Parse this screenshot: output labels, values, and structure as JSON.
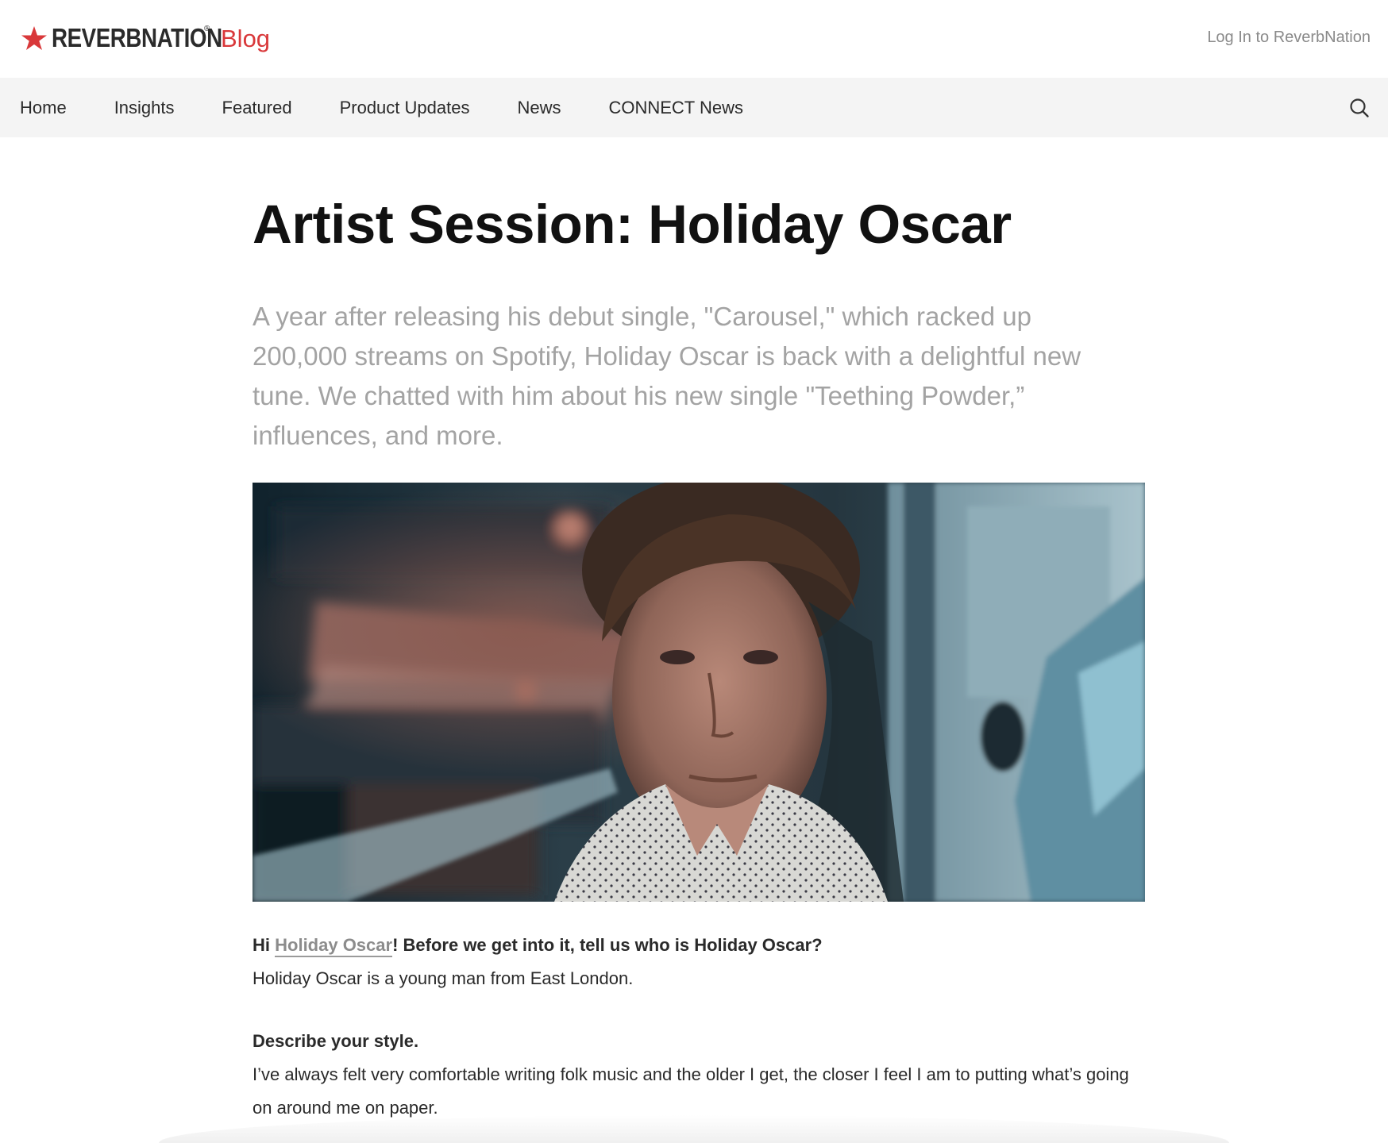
{
  "header": {
    "brand_name": "REVERBNATION",
    "brand_registered": "®",
    "brand_section": "Blog",
    "brand_color": "#d9383a",
    "login_label": "Log In to ReverbNation"
  },
  "nav": {
    "items": [
      {
        "label": "Home"
      },
      {
        "label": "Insights"
      },
      {
        "label": "Featured"
      },
      {
        "label": "Product Updates"
      },
      {
        "label": "News"
      },
      {
        "label": "CONNECT News"
      }
    ],
    "search_icon": "search-icon"
  },
  "article": {
    "title": "Artist Session: Holiday Oscar",
    "lede": "A year after releasing his debut single, \"Carousel,\" which racked up 200,000 streams on Spotify, Holiday Oscar is back with a delightful new tune. We chatted with him about his new single \"Teething Powder,” influences, and more.",
    "hero_image": "portrait-photo",
    "qa": [
      {
        "question_prefix": "Hi ",
        "question_link": "Holiday Oscar",
        "question_suffix": "! Before we get into it, tell us who is Holiday Oscar?",
        "answer": "Holiday Oscar is a young man from East London."
      },
      {
        "question": "Describe your style.",
        "answer": "I’ve always felt very comfortable writing folk music and the older I get, the closer I feel I am to putting what’s going on around me on paper."
      }
    ]
  }
}
